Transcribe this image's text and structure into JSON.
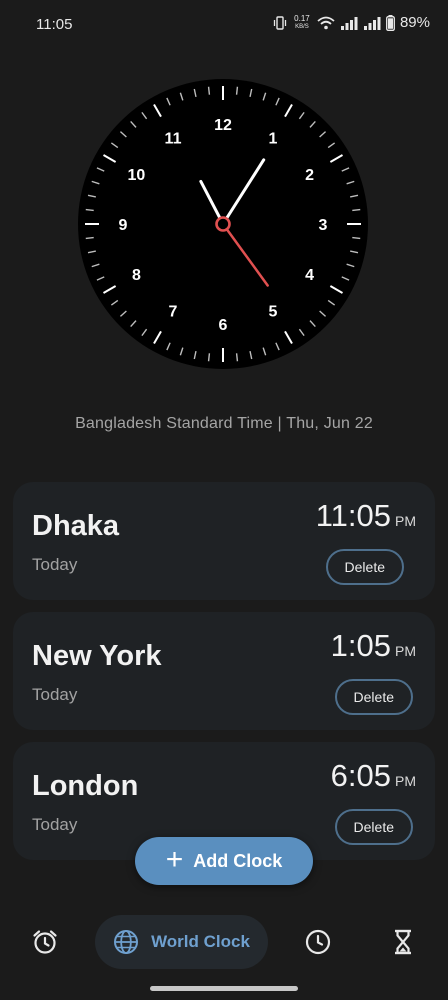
{
  "status_bar": {
    "time": "11:05",
    "net_speed_value": "0.17",
    "net_speed_unit": "KB/S",
    "battery_percent": "89%"
  },
  "analog_clock": {
    "numerals": [
      "12",
      "1",
      "2",
      "3",
      "4",
      "5",
      "6",
      "7",
      "8",
      "9",
      "10",
      "11"
    ],
    "hour": 11,
    "minute": 5,
    "second": 24,
    "face_color": "#000000",
    "hand_color": "#ffffff",
    "second_hand_color": "#e05050"
  },
  "timezone_line": "Bangladesh Standard Time | Thu, Jun 22",
  "cities": [
    {
      "name": "Dhaka",
      "day": "Today",
      "time": "11:05",
      "ampm": "PM",
      "delete_label": "Delete"
    },
    {
      "name": "New York",
      "day": "Today",
      "time": "1:05",
      "ampm": "PM",
      "delete_label": "Delete"
    },
    {
      "name": "London",
      "day": "Today",
      "time": "6:05",
      "ampm": "PM",
      "delete_label": "Delete"
    }
  ],
  "add_clock_label": "Add Clock",
  "nav": {
    "items": [
      {
        "icon": "alarm-icon"
      },
      {
        "icon": "globe-icon",
        "label": "World Clock",
        "active": true
      },
      {
        "icon": "stopwatch-icon"
      },
      {
        "icon": "hourglass-icon"
      }
    ]
  },
  "colors": {
    "background": "#1b1b1b",
    "card": "#1f2225",
    "accent": "#5a8fbf",
    "delete_border": "#4e6f8c"
  }
}
